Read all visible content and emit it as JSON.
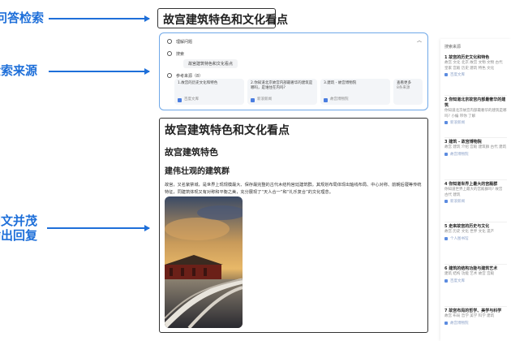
{
  "annotations": [
    {
      "text": "问答检索"
    },
    {
      "text": "检索来源"
    },
    {
      "text": "图文并茂"
    },
    {
      "text": "输出回复"
    }
  ],
  "query": "故宫建筑特色和文化看点",
  "search_panel": {
    "understand_label": "理解问题",
    "search_label": "搜索",
    "search_query": "故宫建筑特色和文化看点",
    "sources_label": "参考来源（8）",
    "cards": [
      {
        "title": "1.故宫的历史文化和特色",
        "site": "百度文库"
      },
      {
        "title": "2.你知道北京故宫内部最奢华的建筑是哪吗，是谁住在内吗?",
        "site": "新浪新闻"
      },
      {
        "title": "3.建筑 - 故宫博物院",
        "site": "故宫博物院"
      }
    ],
    "more": {
      "label": "查看更多",
      "count": "8条来源"
    }
  },
  "answer": {
    "h1": "故宫建筑特色和文化看点",
    "h2": "故宫建筑特色",
    "h3": "建伟壮观的建筑群",
    "paragraph": "故宫，又名紫禁城，是世界上现规模最大、保存最完整的古代木结构宫廷建筑群。其规划布局体现出轴线布局、中心对称、前朝后寝等传统特征，同建筑体现又有对称和平衡之美，充分展现了“天人合一”和“礼乐复合”的文化理念。"
  },
  "sidebar": {
    "header": "搜索来源",
    "items": [
      {
        "title": "1 故宫的历史文化和特色",
        "text": "故宫 文化 北京 故宫 文物 文物 古代 皇家 宫殿 历史 建筑 特色 文化",
        "site": "百度文库"
      },
      {
        "title": "2 你知道北京故宫内部最奢华的建筑",
        "text": "你知道北京故宫内部最奢华的建筑是哪吗? 小编 带你 了解",
        "site": "新浪新闻"
      },
      {
        "title": "3 建筑 - 故宫博物院",
        "text": "故宫 建筑 介绍 宫殿 建筑群 古代 建筑",
        "site": "故宫博物院"
      },
      {
        "title": "4 你知道世界上最大的宫殿群",
        "text": "你知道世界上最大的宫殿群吗? 故宫 古代 建筑",
        "site": "新浪新闻"
      },
      {
        "title": "5 走来故宫的历史与文化",
        "text": "故宫 历史 文化 世界 文化 遗产",
        "site": "个人图书馆"
      },
      {
        "title": "6 建筑的结构功能与建筑艺术",
        "text": "建筑 结构 功能 艺术 故宫 宫殿",
        "site": "百度文库"
      },
      {
        "title": "7 故宫布局的哲学、美学与科学",
        "text": "故宫 布局 哲学 美学 科学 建筑",
        "site": "故宫博物院"
      }
    ]
  },
  "colors": {
    "accent": "#1e6fd9",
    "panel_border": "#6fa8e8"
  }
}
